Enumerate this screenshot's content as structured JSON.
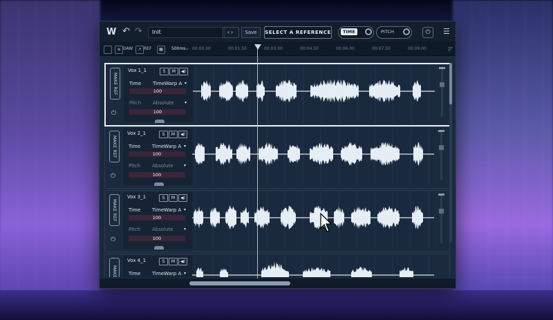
{
  "toolbar": {
    "logo": "W",
    "undo_icon": "↶",
    "redo_icon": "↷",
    "preset_name": "Init",
    "nav_arrows": "‹›",
    "save_label": "Save",
    "select_reference_label": "SELECT A REFERENCE",
    "time_label": "TIME",
    "pitch_label": "PITCH",
    "power_icon": "⏻",
    "menu_icon": "☰"
  },
  "ruler": {
    "daw_label": "DAW",
    "ref_label": "REF",
    "offset_label": "500ms⌵",
    "ticks": [
      "00:00.00",
      "00:01.50",
      "00:03.00",
      "00:04.50",
      "00:06.00",
      "00:07.50",
      "00:09.00"
    ]
  },
  "tracks": [
    {
      "name": "Vox 1_1",
      "make_ref": "MAKE REF",
      "time_label": "Time",
      "time_mode": "TimeWarp A",
      "time_value": "100",
      "pitch_label": "Pitch",
      "pitch_mode": "Absolute",
      "pitch_value": "100",
      "selected": true
    },
    {
      "name": "Vox 2_1",
      "make_ref": "MAKE REF",
      "time_label": "Time",
      "time_mode": "TimeWarp A",
      "time_value": "100",
      "pitch_label": "Pitch",
      "pitch_mode": "Absolute",
      "pitch_value": "100",
      "selected": false
    },
    {
      "name": "Vox 3_1",
      "make_ref": "MAKE REF",
      "time_label": "Time",
      "time_mode": "TimeWarp A",
      "time_value": "100",
      "pitch_label": "Pitch",
      "pitch_mode": "Absolute",
      "pitch_value": "100",
      "selected": false
    },
    {
      "name": "Vox 4_1",
      "make_ref": "MAKE R",
      "time_label": "Time",
      "time_mode": "TimeWarp A",
      "time_value": "",
      "pitch_label": "",
      "pitch_mode": "",
      "pitch_value": "",
      "selected": false
    }
  ],
  "solo_label": "S",
  "mute_label": "M",
  "speaker_icon": "◀)",
  "caret": "▾",
  "colors": {
    "accent": "#e8eef6",
    "panel": "#1a2a3e",
    "waveform": "#e6edf4"
  }
}
